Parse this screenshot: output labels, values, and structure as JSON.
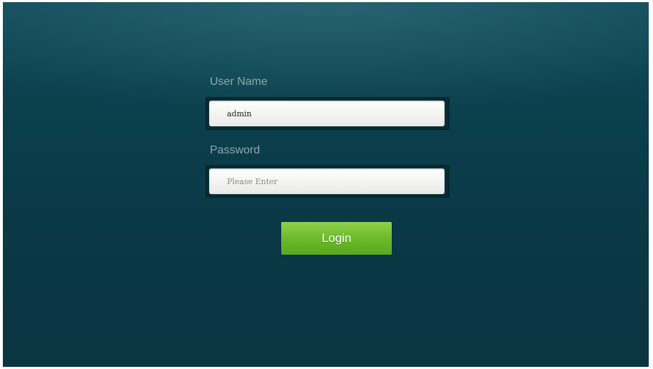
{
  "login_form": {
    "username_label": "User Name",
    "username_value": "admin",
    "password_label": "Password",
    "password_placeholder": "Please Enter",
    "login_label": "Login"
  },
  "colors": {
    "background": "#0b3e4b",
    "label_text": "#8fa7ad",
    "button": "#6cbb2a"
  }
}
